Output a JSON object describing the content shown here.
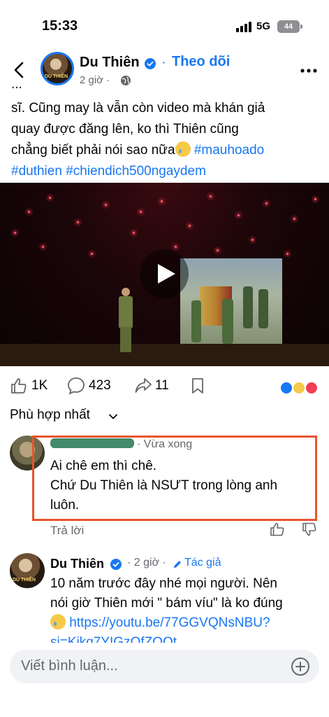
{
  "status_bar": {
    "time": "15:33",
    "network": "5G",
    "battery": "44"
  },
  "header": {
    "author": "Du Thiên",
    "separator": "·",
    "follow_label": "Theo dõi",
    "time": "2 giờ ·"
  },
  "post": {
    "partial_line": "...",
    "line1": "sĩ. Cũng may là vẫn còn video mà khán giả",
    "line2": "quay được đăng lên, ko thì Thiên cũng",
    "line3_prefix": "chẳng biết phải nói sao nữa",
    "hashtag1": "#mauhoado",
    "hashtag2": "#duthien",
    "hashtag3": "#chiendich500ngaydem"
  },
  "stats": {
    "likes": "1K",
    "comments": "423",
    "shares": "11"
  },
  "sort_label": "Phù hợp nhất",
  "comment1": {
    "time": "· Vừa xong",
    "line1": "Ai chê em thì chê.",
    "line2": "Chứ Du Thiên là NSƯT trong lòng anh",
    "line3": "luôn.",
    "reply_label": "Trả lời"
  },
  "comment2": {
    "name": "Du Thiên",
    "time": "· 2 giờ ·",
    "role": "Tác giả",
    "line1": "10 năm trước đây nhé mọi người. Nên",
    "line2": "nói giờ Thiên mới \" bám víu\" là ko đúng",
    "link1": "https://youtu.be/77GGVQNsNBU?",
    "link2": "si=Kikq7YIGzOfZOQt"
  },
  "composer": {
    "placeholder": "Viết bình luận..."
  },
  "colors": {
    "accent": "#1877f2",
    "highlight_border": "#e8542c",
    "secondary_text": "#65676b"
  }
}
